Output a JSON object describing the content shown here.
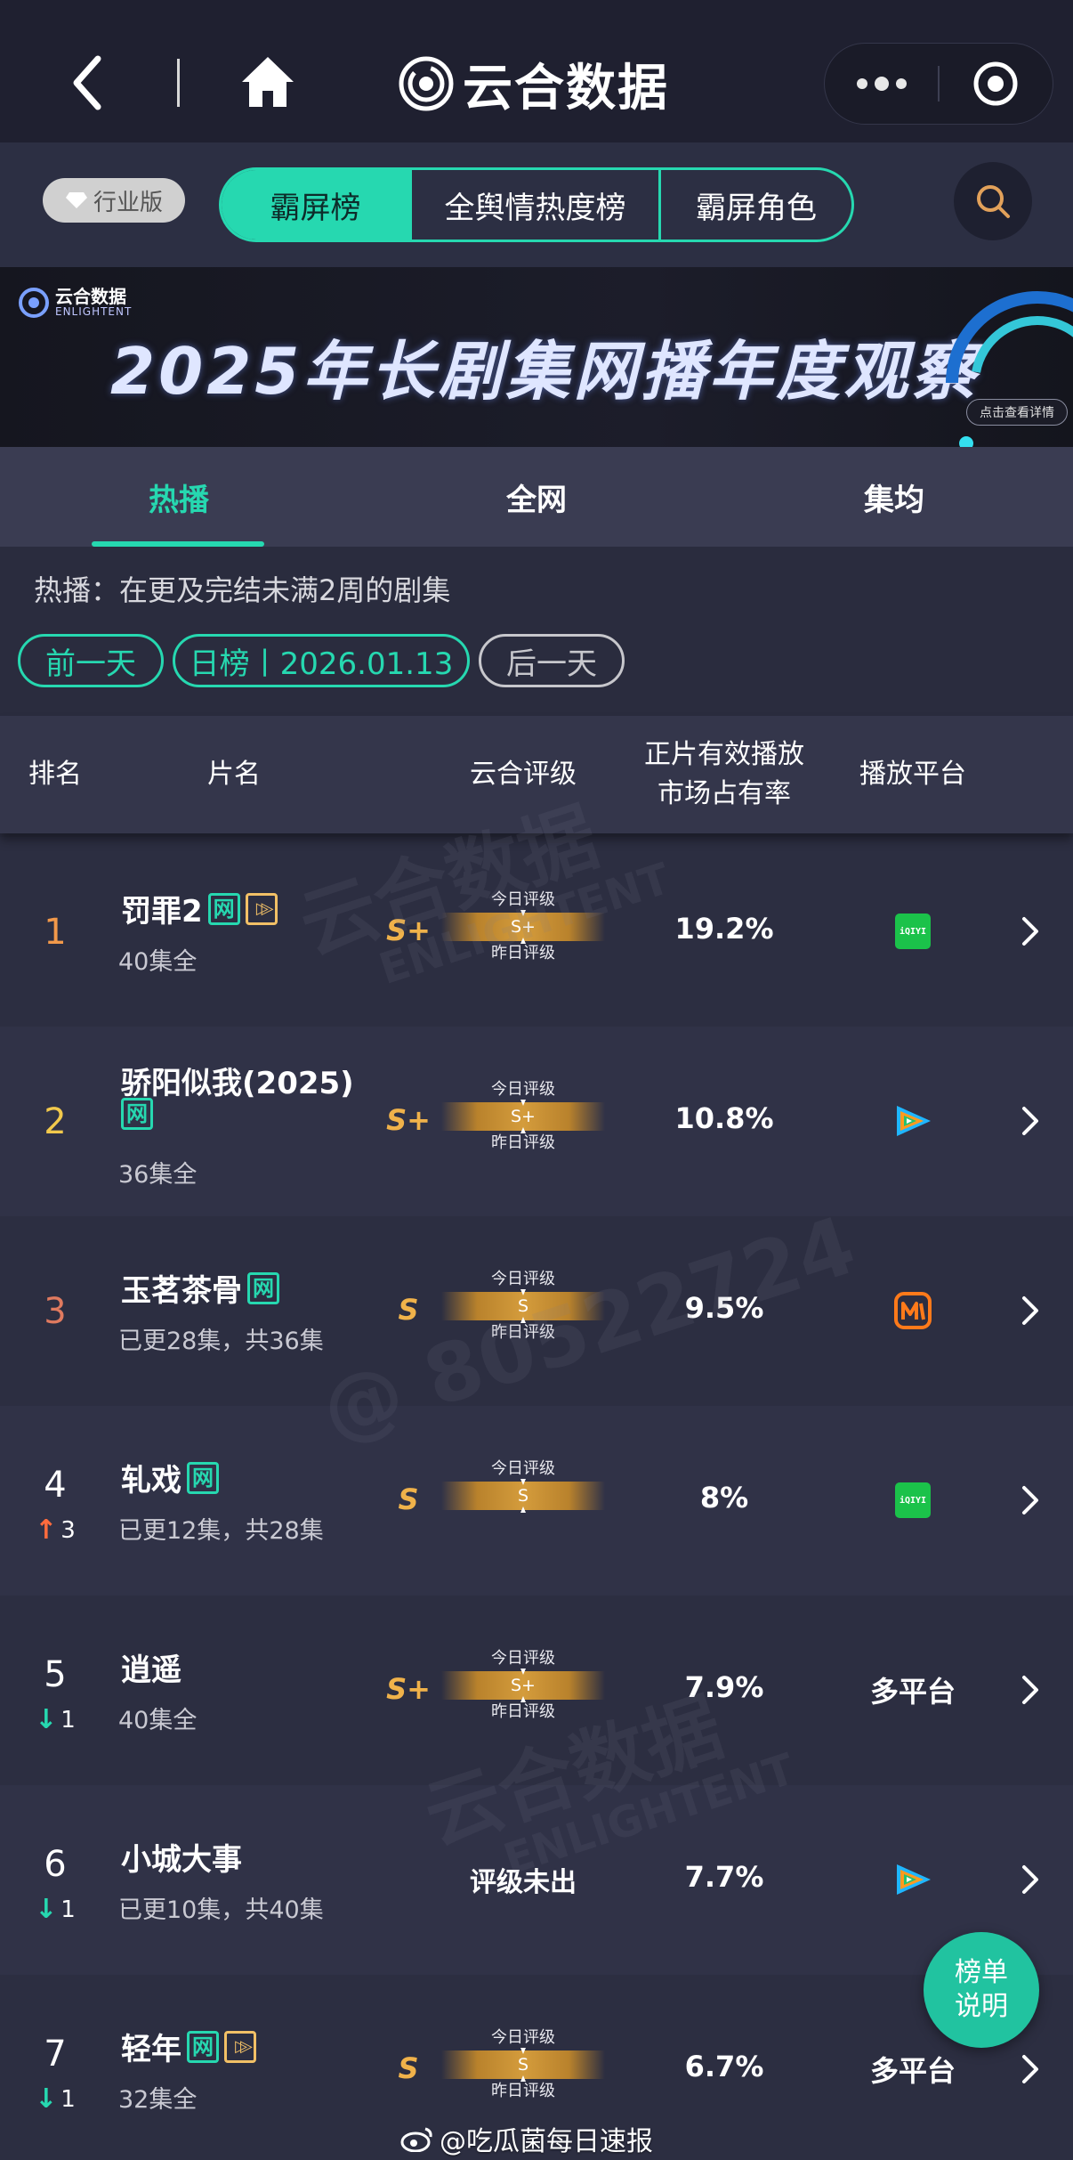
{
  "nav": {
    "app_title": "云合数据",
    "icons": [
      "back-icon",
      "home-icon",
      "more-icon",
      "target-close-icon"
    ]
  },
  "category": {
    "edition_label": "行业版",
    "tabs": [
      {
        "label": "霸屏榜",
        "active": true
      },
      {
        "label": "全舆情热度榜",
        "active": false
      },
      {
        "label": "霸屏角色",
        "active": false
      }
    ]
  },
  "banner": {
    "brand_cn": "云合数据",
    "brand_en": "ENLIGHTENT",
    "title": "2025年长剧集网播年度观察",
    "cta": "点击查看详情"
  },
  "subtabs": [
    {
      "label": "热播",
      "active": true
    },
    {
      "label": "全网",
      "active": false
    },
    {
      "label": "集均",
      "active": false
    }
  ],
  "filter": {
    "desc": "热播：在更及完结未满2周的剧集",
    "prev_label": "前一天",
    "current_label": "日榜丨2026.01.13",
    "next_label": "后一天"
  },
  "table": {
    "headers": {
      "rank": "排名",
      "title": "片名",
      "grade": "云合评级",
      "share_line1": "正片有效播放",
      "share_line2": "市场占有率",
      "platform": "播放平台"
    },
    "meter_labels": {
      "today": "今日评级",
      "yesterday": "昨日评级"
    },
    "rows": [
      {
        "rank": "1",
        "trend": "",
        "trend_dir": "",
        "title": "罚罪2",
        "title_line2": "",
        "badges": [
          "网",
          "play"
        ],
        "sub": "40集全",
        "grade": "S+",
        "today_grade": "S+",
        "show_yesterday": true,
        "share": "19.2%",
        "platform": "iqiyi"
      },
      {
        "rank": "2",
        "trend": "",
        "trend_dir": "",
        "title": "骄阳似我(2025)",
        "title_line2": "网",
        "badges": [],
        "sub": "36集全",
        "grade": "S+",
        "today_grade": "S+",
        "show_yesterday": true,
        "share": "10.8%",
        "platform": "tencent"
      },
      {
        "rank": "3",
        "trend": "",
        "trend_dir": "",
        "title": "玉茗茶骨",
        "title_line2": "",
        "badges": [
          "网"
        ],
        "sub": "已更28集，共36集",
        "grade": "S",
        "today_grade": "S",
        "show_yesterday": true,
        "share": "9.5%",
        "platform": "mango"
      },
      {
        "rank": "4",
        "trend": "3",
        "trend_dir": "up",
        "title": "轧戏",
        "title_line2": "",
        "badges": [
          "网"
        ],
        "sub": "已更12集，共28集",
        "grade": "S",
        "today_grade": "S",
        "show_yesterday": false,
        "share": "8%",
        "platform": "iqiyi"
      },
      {
        "rank": "5",
        "trend": "1",
        "trend_dir": "down",
        "title": "逍遥",
        "title_line2": "",
        "badges": [],
        "sub": "40集全",
        "grade": "S+",
        "today_grade": "S+",
        "show_yesterday": true,
        "share": "7.9%",
        "platform": "多平台"
      },
      {
        "rank": "6",
        "trend": "1",
        "trend_dir": "down",
        "title": "小城大事",
        "title_line2": "",
        "badges": [],
        "sub": "已更10集，共40集",
        "grade": "",
        "today_grade": "",
        "unrated": "评级未出",
        "show_yesterday": false,
        "share": "7.7%",
        "platform": "tencent"
      },
      {
        "rank": "7",
        "trend": "1",
        "trend_dir": "down",
        "title": "轻年",
        "title_line2": "",
        "badges": [
          "网",
          "play"
        ],
        "sub": "32集全",
        "grade": "S",
        "today_grade": "S",
        "show_yesterday": true,
        "share": "6.7%",
        "platform": "多平台"
      }
    ]
  },
  "float_button": {
    "line1": "榜单",
    "line2": "说明"
  },
  "watermarks": [
    "云合数据",
    "ENLIGHTENT",
    "@ 80522724"
  ],
  "credit": "@吃瓜菌每日速报",
  "colors": {
    "accent": "#26d8b0",
    "grade_gold": "#f0b24a",
    "rank1": "#f2994a",
    "rank2": "#f2c94c",
    "rank3": "#e07a5f",
    "trend_up": "#ff6b3d",
    "trend_down": "#26d8b0"
  }
}
